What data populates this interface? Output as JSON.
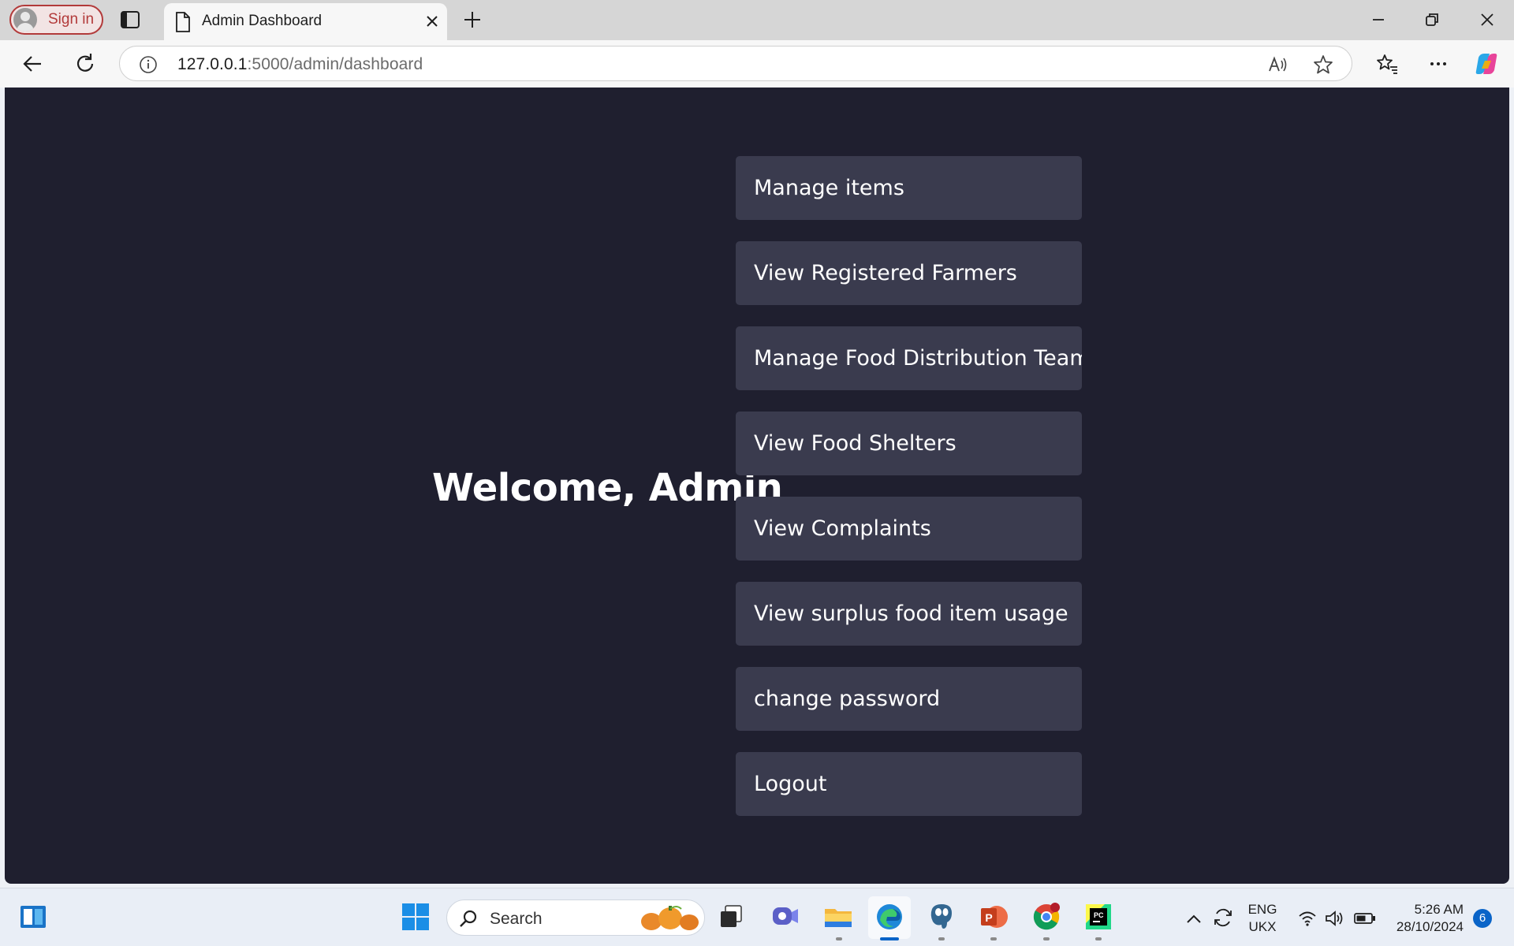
{
  "browser": {
    "sign_in_label": "Sign in",
    "tab_title": "Admin Dashboard",
    "url_host": "127.0.0.1",
    "url_path": ":5000/admin/dashboard"
  },
  "page": {
    "welcome": "Welcome, Admin",
    "menu": [
      {
        "label": "Manage items"
      },
      {
        "label": "View Registered Farmers"
      },
      {
        "label": "Manage Food Distribution Teams"
      },
      {
        "label": "View Food Shelters"
      },
      {
        "label": "View Complaints"
      },
      {
        "label": "View surplus food item usage"
      },
      {
        "label": "change password"
      },
      {
        "label": "Logout"
      }
    ]
  },
  "taskbar": {
    "search_label": "Search",
    "language": "ENG",
    "layout": "UKX",
    "time": "5:26 AM",
    "date": "28/10/2024",
    "notifications": "6"
  },
  "colors": {
    "page_bg": "#1f1f2f",
    "button_bg": "#3a3b4e",
    "text": "#ffffff"
  }
}
